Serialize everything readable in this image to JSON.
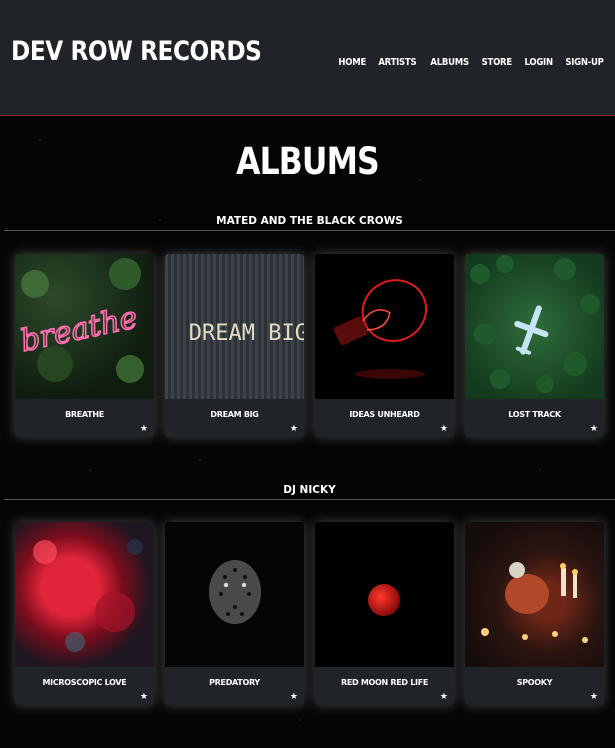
{
  "brand": "DEV ROW RECORDS",
  "nav": [
    "HOME",
    "ARTISTS",
    "ALBUMS",
    "STORE",
    "LOGIN",
    "SIGN-UP"
  ],
  "page_title": "ALBUMS",
  "sections": [
    {
      "artist": "MATED AND THE BLACK CROWS",
      "albums": [
        {
          "title": "BREATHE",
          "art_text": "breathe"
        },
        {
          "title": "DREAM BIG",
          "art_text": "DREAM BIG."
        },
        {
          "title": "IDEAS UNHEARD"
        },
        {
          "title": "LOST TRACK"
        }
      ]
    },
    {
      "artist": "DJ NICKY",
      "albums": [
        {
          "title": "MICROSCOPIC LOVE"
        },
        {
          "title": "PREDATORY"
        },
        {
          "title": "RED MOON RED LIFE"
        },
        {
          "title": "SPOOKY"
        }
      ]
    }
  ],
  "icons": {
    "favorite": "star-icon"
  },
  "colors": {
    "header_bg": "#202327",
    "card_bg": "#202327",
    "accent": "#7a2a2a"
  }
}
